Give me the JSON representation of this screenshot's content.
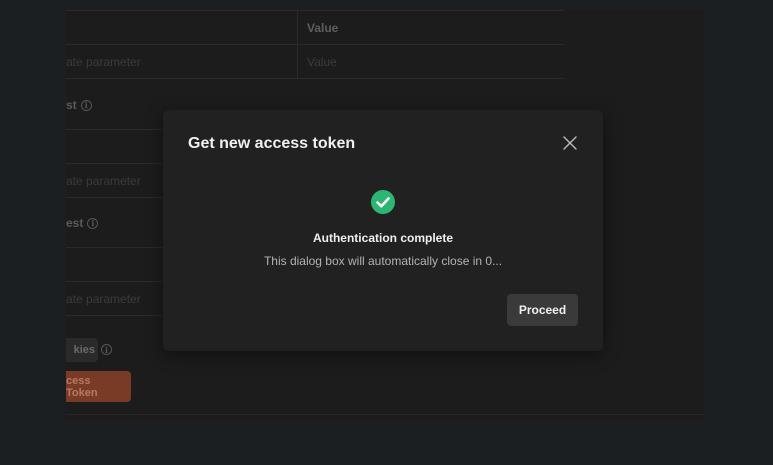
{
  "background": {
    "table1": {
      "header_value": "Value",
      "row_key_placeholder": "ate parameter",
      "row_value_placeholder": "Value"
    },
    "label1": "st",
    "table2": {
      "row_key_placeholder": "ate parameter"
    },
    "label2": "est",
    "table3": {
      "row_key_placeholder": "ate parameter"
    },
    "cookies_button": "kies",
    "token_button": "cess Token"
  },
  "modal": {
    "title": "Get new access token",
    "status_title": "Authentication complete",
    "status_message": "This dialog box will automatically close in 0...",
    "proceed_label": "Proceed"
  },
  "colors": {
    "success": "#2bb673",
    "accent": "#ff6c37"
  }
}
